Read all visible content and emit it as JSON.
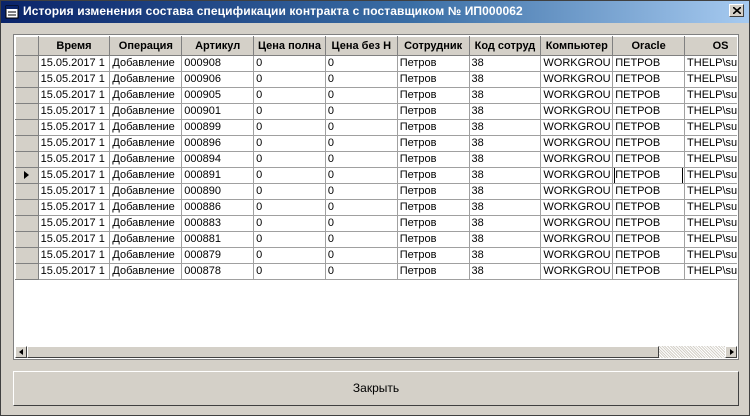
{
  "window": {
    "title": "История изменения состава спецификации контракта с поставщиком № ИП000062"
  },
  "icons": {
    "app": "window-icon",
    "close": "close-icon",
    "current_row": "row-pointer-icon",
    "scroll_left": "arrow-left-icon",
    "scroll_right": "arrow-right-icon"
  },
  "grid": {
    "columns": [
      "Время",
      "Операция",
      "Артикул",
      "Цена полна",
      "Цена без Н",
      "Сотрудник",
      "Код сотруд",
      "Компьютер",
      "Oracle",
      "OS"
    ],
    "current_row_index": 7,
    "focused_column": "Oracle",
    "rows": [
      [
        "15.05.2017 1",
        "Добавление",
        "000908",
        "0",
        "0",
        "Петров",
        "38",
        "WORKGROU",
        "ПЕТРОВ",
        "THELP\\super"
      ],
      [
        "15.05.2017 1",
        "Добавление",
        "000906",
        "0",
        "0",
        "Петров",
        "38",
        "WORKGROU",
        "ПЕТРОВ",
        "THELP\\super"
      ],
      [
        "15.05.2017 1",
        "Добавление",
        "000905",
        "0",
        "0",
        "Петров",
        "38",
        "WORKGROU",
        "ПЕТРОВ",
        "THELP\\super"
      ],
      [
        "15.05.2017 1",
        "Добавление",
        "000901",
        "0",
        "0",
        "Петров",
        "38",
        "WORKGROU",
        "ПЕТРОВ",
        "THELP\\super"
      ],
      [
        "15.05.2017 1",
        "Добавление",
        "000899",
        "0",
        "0",
        "Петров",
        "38",
        "WORKGROU",
        "ПЕТРОВ",
        "THELP\\super"
      ],
      [
        "15.05.2017 1",
        "Добавление",
        "000896",
        "0",
        "0",
        "Петров",
        "38",
        "WORKGROU",
        "ПЕТРОВ",
        "THELP\\super"
      ],
      [
        "15.05.2017 1",
        "Добавление",
        "000894",
        "0",
        "0",
        "Петров",
        "38",
        "WORKGROU",
        "ПЕТРОВ",
        "THELP\\super"
      ],
      [
        "15.05.2017 1",
        "Добавление",
        "000891",
        "0",
        "0",
        "Петров",
        "38",
        "WORKGROU",
        "ПЕТРОВ",
        "THELP\\super"
      ],
      [
        "15.05.2017 1",
        "Добавление",
        "000890",
        "0",
        "0",
        "Петров",
        "38",
        "WORKGROU",
        "ПЕТРОВ",
        "THELP\\super"
      ],
      [
        "15.05.2017 1",
        "Добавление",
        "000886",
        "0",
        "0",
        "Петров",
        "38",
        "WORKGROU",
        "ПЕТРОВ",
        "THELP\\super"
      ],
      [
        "15.05.2017 1",
        "Добавление",
        "000883",
        "0",
        "0",
        "Петров",
        "38",
        "WORKGROU",
        "ПЕТРОВ",
        "THELP\\super"
      ],
      [
        "15.05.2017 1",
        "Добавление",
        "000881",
        "0",
        "0",
        "Петров",
        "38",
        "WORKGROU",
        "ПЕТРОВ",
        "THELP\\super"
      ],
      [
        "15.05.2017 1",
        "Добавление",
        "000879",
        "0",
        "0",
        "Петров",
        "38",
        "WORKGROU",
        "ПЕТРОВ",
        "THELP\\super"
      ],
      [
        "15.05.2017 1",
        "Добавление",
        "000878",
        "0",
        "0",
        "Петров",
        "38",
        "WORKGROU",
        "ПЕТРОВ",
        "THELP\\super"
      ]
    ]
  },
  "buttons": {
    "close_label": "Закрыть"
  },
  "colors": {
    "titlebar_start": "#0a246a",
    "titlebar_end": "#a6caf0",
    "face": "#d4d0c8"
  }
}
